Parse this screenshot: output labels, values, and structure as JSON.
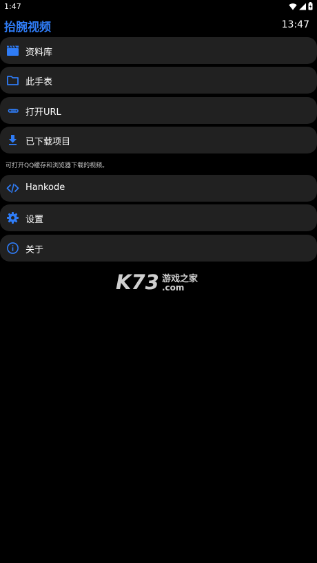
{
  "status_bar": {
    "time": "1:47",
    "icons": [
      "wifi-icon",
      "signal-icon",
      "battery-icon"
    ]
  },
  "header": {
    "title": "抬腕视频",
    "clock": "13:47"
  },
  "menu": [
    {
      "icon": "video-library-icon",
      "label": "资料库"
    },
    {
      "icon": "folder-icon",
      "label": "此手表"
    },
    {
      "icon": "attachment-icon",
      "label": "打开URL"
    },
    {
      "icon": "download-icon",
      "label": "已下载项目"
    }
  ],
  "hint": "可打开QQ缓存和浏览器下载的视频。",
  "menu2": [
    {
      "icon": "code-icon",
      "label": "Hankode"
    },
    {
      "icon": "gear-icon",
      "label": "设置"
    },
    {
      "icon": "info-icon",
      "label": "关于"
    }
  ],
  "watermark": {
    "brand": "K73",
    "cn_text": "游戏之家",
    "domain": ".com"
  },
  "colors": {
    "accent": "#2f7cf6",
    "item_bg": "#212121",
    "background": "#000000"
  }
}
